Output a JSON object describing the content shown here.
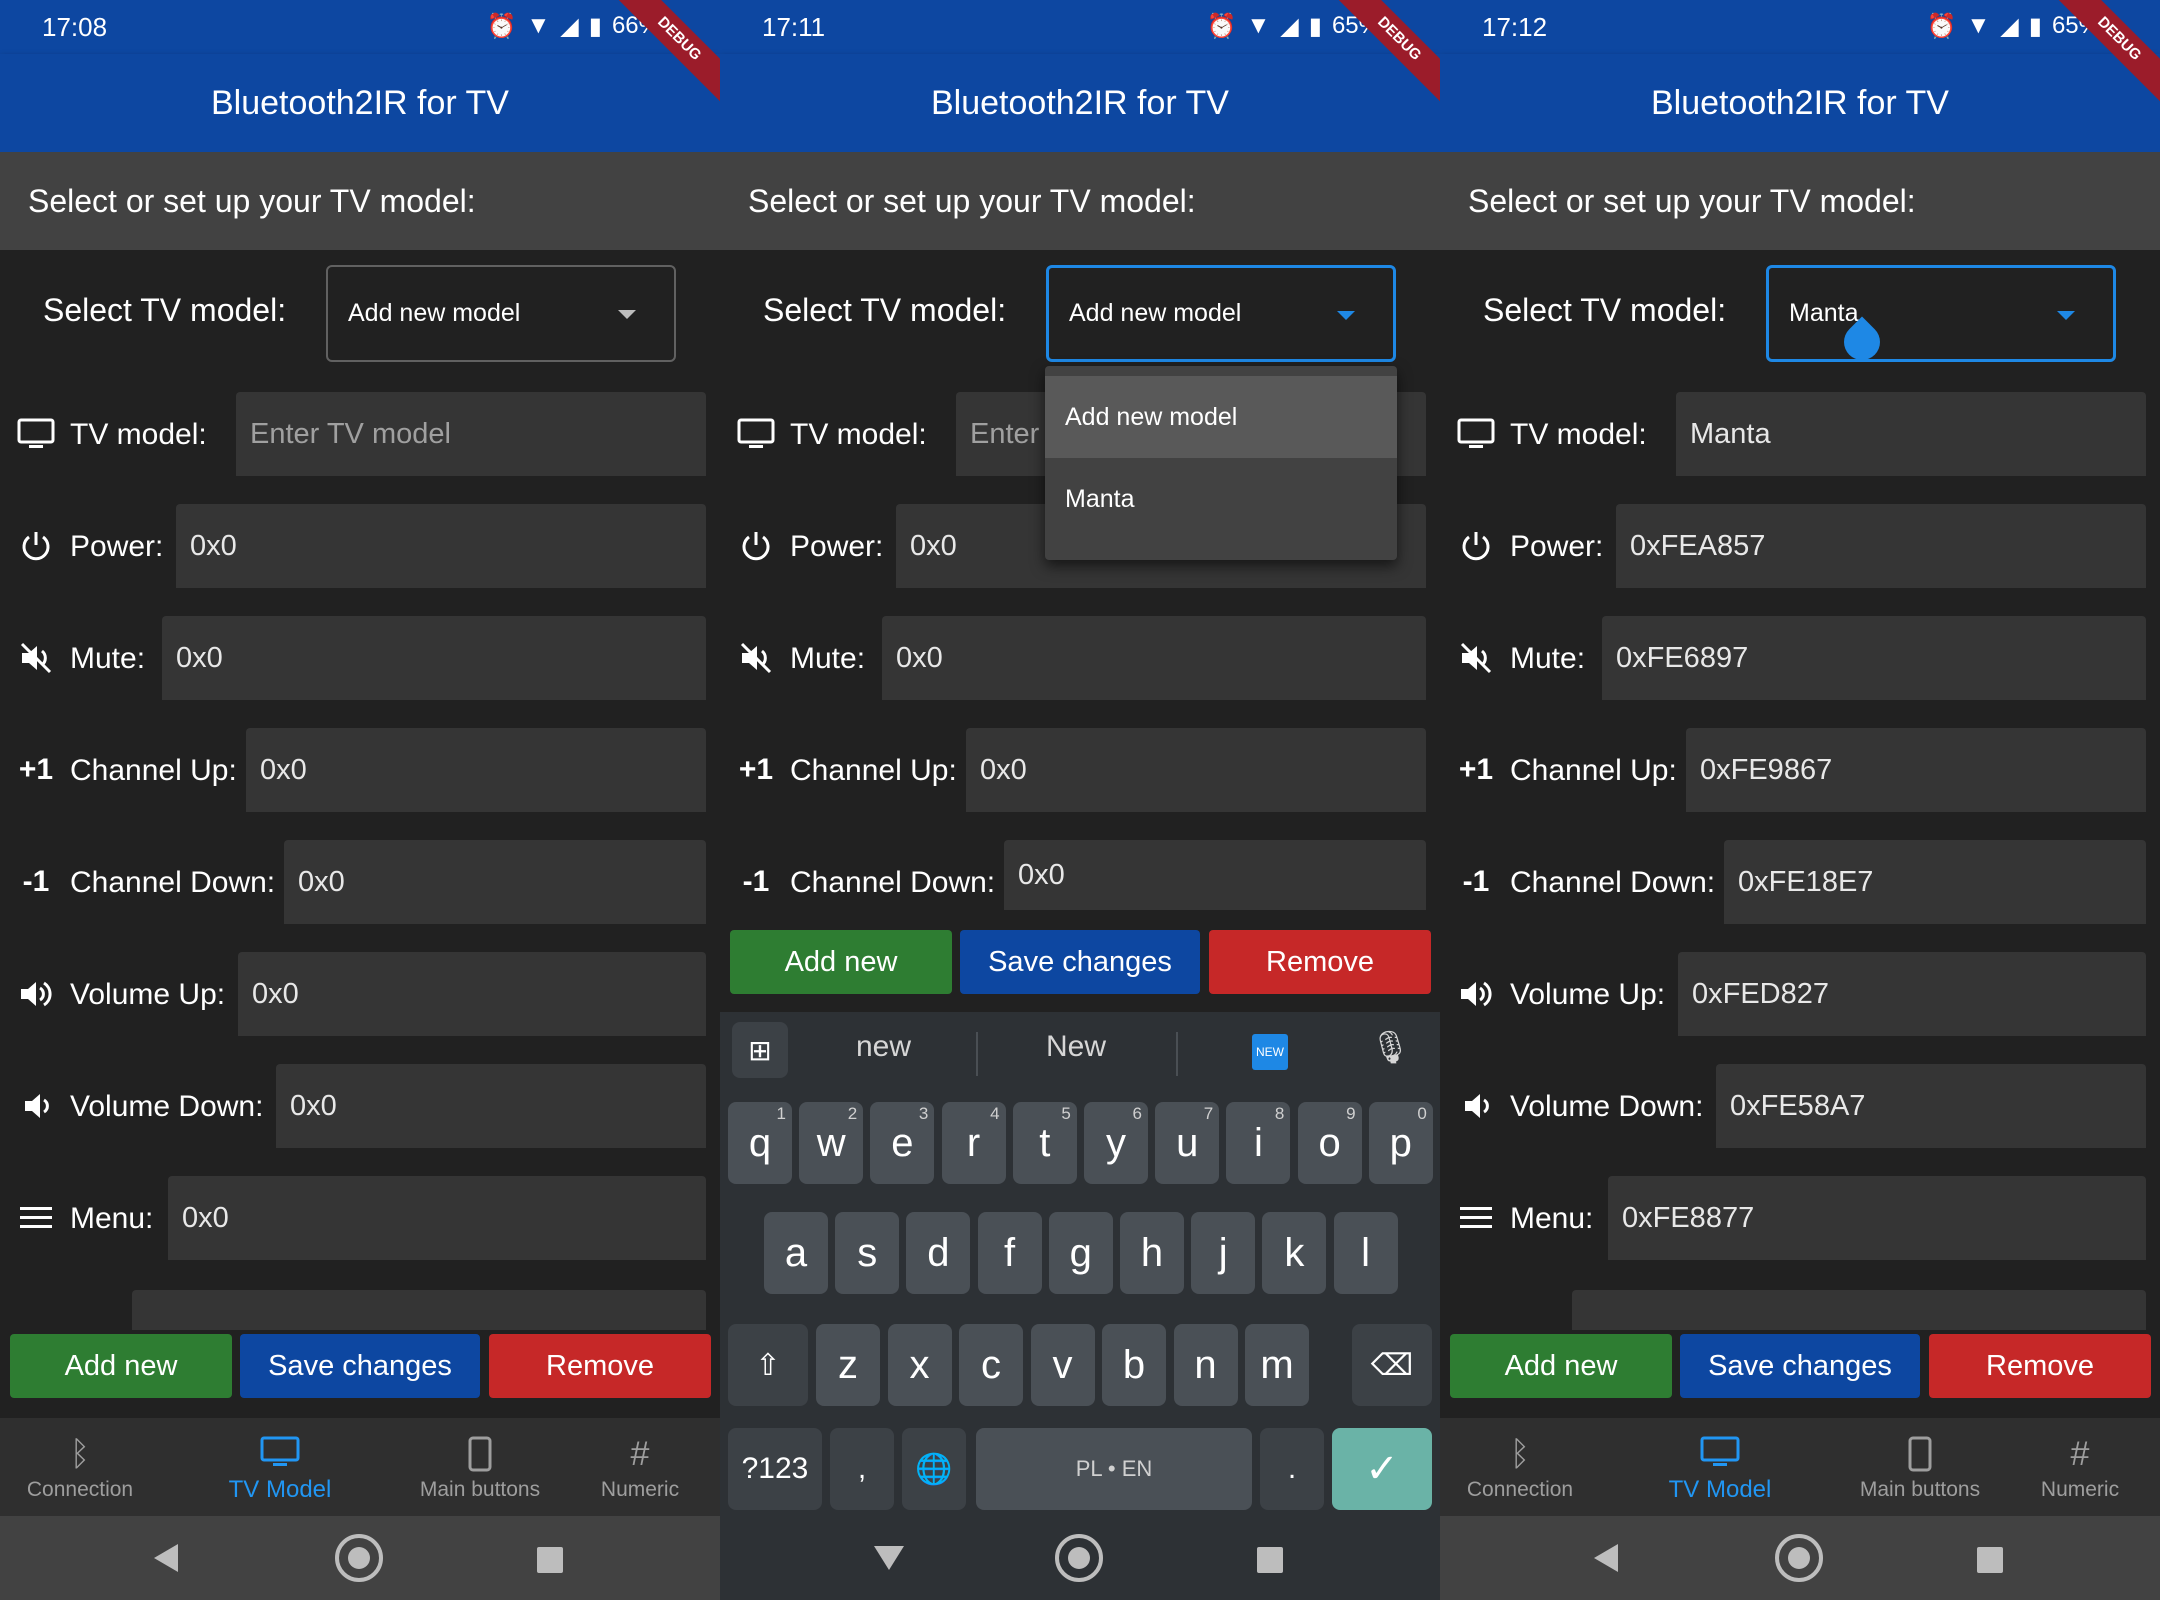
{
  "app_title": "Bluetooth2IR for TV",
  "ribbon_text": "DEBUG",
  "subheader": "Select or set up your TV model:",
  "select_label": "Select TV model:",
  "labels": {
    "tv_model": "TV model:",
    "power": "Power:",
    "mute": "Mute:",
    "channel_up": "Channel Up:",
    "channel_down": "Channel Down:",
    "volume_up": "Volume Up:",
    "volume_down": "Volume Down:",
    "menu": "Menu:"
  },
  "icons": {
    "tv_model": "tv-icon",
    "power": "power-icon",
    "mute": "mute-icon",
    "channel_up": "plus-one-icon",
    "channel_down": "minus-one-icon",
    "volume_up": "volume-up-icon",
    "volume_down": "volume-down-icon",
    "menu": "menu-icon"
  },
  "row_icon_text": {
    "channel_up": "+1",
    "channel_down": "-1"
  },
  "buttons": {
    "add": "Add new",
    "save": "Save changes",
    "remove": "Remove"
  },
  "nav": {
    "connection": "Connection",
    "tv_model": "TV Model",
    "main_buttons": "Main buttons",
    "numeric": "Numeric"
  },
  "colors": {
    "appbar": "#0d47a1",
    "accent": "#2196f3",
    "add": "#2e7d32",
    "save": "#0d47a1",
    "remove": "#c62828"
  },
  "screens": [
    {
      "time": "17:08",
      "battery": "66%",
      "selected_model": "Add new model",
      "tv_model_placeholder": "Enter TV model",
      "values": {
        "power": "0x0",
        "mute": "0x0",
        "channel_up": "0x0",
        "channel_down": "0x0",
        "volume_up": "0x0",
        "volume_down": "0x0",
        "menu": "0x0"
      }
    },
    {
      "time": "17:11",
      "battery": "65%",
      "selected_model": "Add new model",
      "tv_model_placeholder": "Enter",
      "dropdown_options": [
        "Add new model",
        "Manta"
      ],
      "values": {
        "power": "0x0",
        "mute": "0x0",
        "channel_up": "0x0",
        "channel_down": "0x0"
      },
      "keyboard": {
        "suggestions": [
          "new",
          "New"
        ],
        "row1": [
          "q",
          "w",
          "e",
          "r",
          "t",
          "y",
          "u",
          "i",
          "o",
          "p"
        ],
        "row1_hints": [
          "1",
          "2",
          "3",
          "4",
          "5",
          "6",
          "7",
          "8",
          "9",
          "0"
        ],
        "row2": [
          "a",
          "s",
          "d",
          "f",
          "g",
          "h",
          "j",
          "k",
          "l"
        ],
        "row3": [
          "z",
          "x",
          "c",
          "v",
          "b",
          "n",
          "m"
        ],
        "symbols": "?123",
        "comma": ",",
        "space": "PL • EN",
        "period": ".",
        "new_badge": "NEW"
      }
    },
    {
      "time": "17:12",
      "battery": "65%",
      "selected_model": "Manta",
      "tv_model_value": "Manta",
      "values": {
        "power": "0xFEA857",
        "mute": "0xFE6897",
        "channel_up": "0xFE9867",
        "channel_down": "0xFE18E7",
        "volume_up": "0xFED827",
        "volume_down": "0xFE58A7",
        "menu": "0xFE8877"
      }
    }
  ]
}
